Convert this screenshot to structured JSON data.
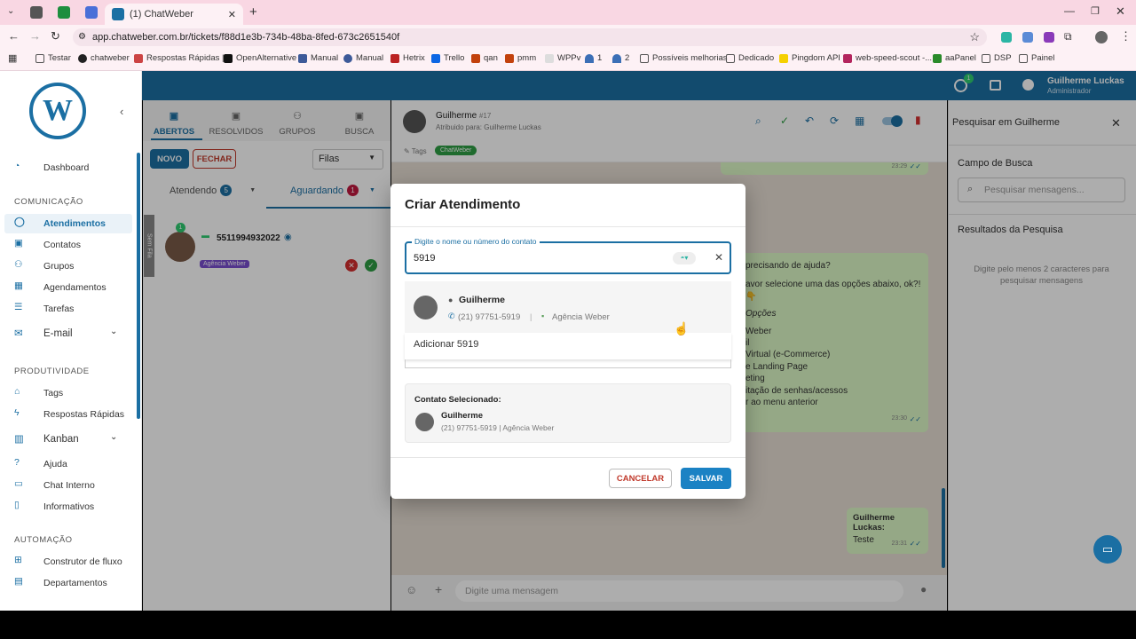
{
  "browser": {
    "tab_title": "(1) ChatWeber",
    "url": "app.chatweber.com.br/tickets/f88d1e3b-734b-48ba-8fed-673c2651540f",
    "bookmarks": [
      "Testar",
      "chatweber",
      "Respostas Rápidas |...",
      "OpenAlternative",
      "Manual",
      "Manual",
      "Hetrix",
      "Trello",
      "qan",
      "pmm",
      "WPPv",
      "1",
      "2",
      "Possíveis melhorias",
      "Dedicado",
      "Pingdom API",
      "web-speed-scout -...",
      "aaPanel",
      "DSP",
      "Painel"
    ]
  },
  "header": {
    "user_name": "Guilherme Luckas",
    "user_role": "Administrador",
    "whatsapp_badge": "1"
  },
  "sidebar": {
    "dashboard": "Dashboard",
    "sec_comunicacao": "COMUNICAÇÃO",
    "atendimentos": "Atendimentos",
    "contatos": "Contatos",
    "grupos": "Grupos",
    "agendamentos": "Agendamentos",
    "tarefas": "Tarefas",
    "email": "E-mail",
    "sec_produtividade": "PRODUTIVIDADE",
    "tags": "Tags",
    "respostas": "Respostas Rápidas",
    "kanban": "Kanban",
    "ajuda": "Ajuda",
    "chat_interno": "Chat Interno",
    "informativos": "Informativos",
    "sec_automacao": "AUTOMAÇÃO",
    "construtor": "Construtor de fluxo",
    "departamentos": "Departamentos"
  },
  "tickets": {
    "tabs": [
      "ABERTOS",
      "RESOLVIDOS",
      "GRUPOS",
      "BUSCA"
    ],
    "novo": "NOVO",
    "fechar": "FECHAR",
    "filas": "Filas",
    "atendendo": "Atendendo",
    "atendendo_count": "5",
    "aguardando": "Aguardando",
    "aguardando_count": "1",
    "sem_fila": "Sem Fila",
    "item_phone": "5511994932022",
    "item_tag": "Agência Weber",
    "item_badge": "1"
  },
  "chat": {
    "contact_name": "Guilherme",
    "ticket_no": "#17",
    "assigned": "Atribuido para: Guilherme Luckas",
    "tags_label": "Tags",
    "tag": "ChatWeber",
    "time_top": "23:29",
    "menu_lines": [
      "precisando de ajuda?",
      "avor selecione uma das opções abaixo, ok?! 👇",
      "Opções",
      "Weber",
      "il",
      "Virtual (e-Commerce)",
      "e Landing Page",
      "eting",
      "itação de senhas/acessos",
      "r ao menu anterior"
    ],
    "menu_time": "23:30",
    "reply_author": "Guilherme Luckas:",
    "reply_text": "Teste",
    "reply_time": "23:31",
    "composer_placeholder": "Digite uma mensagem"
  },
  "search_panel": {
    "title": "Pesquisar em Guilherme",
    "campo": "Campo de Busca",
    "placeholder": "Pesquisar mensagens...",
    "resultados": "Resultados da Pesquisa",
    "hint": "Digite pelo menos 2 caracteres para pesquisar mensagens"
  },
  "modal": {
    "title": "Criar Atendimento",
    "input_label": "Digite o nome ou número do contato",
    "input_value": "5919",
    "option_name": "Guilherme",
    "option_phone": "(21) 97751-5919",
    "option_sep": "|",
    "option_company": "Agência Weber",
    "add_option": "Adicionar 5919",
    "selected_label": "Contato Selecionado:",
    "selected_name": "Guilherme",
    "selected_details": "(21) 97751-5919 | Agência Weber",
    "cancel": "CANCELAR",
    "save": "SALVAR"
  },
  "colors": {
    "primary": "#1b6fa3",
    "accent_green": "#25a244",
    "danger": "#d32f2f",
    "bubble": "#dcf8c6"
  }
}
